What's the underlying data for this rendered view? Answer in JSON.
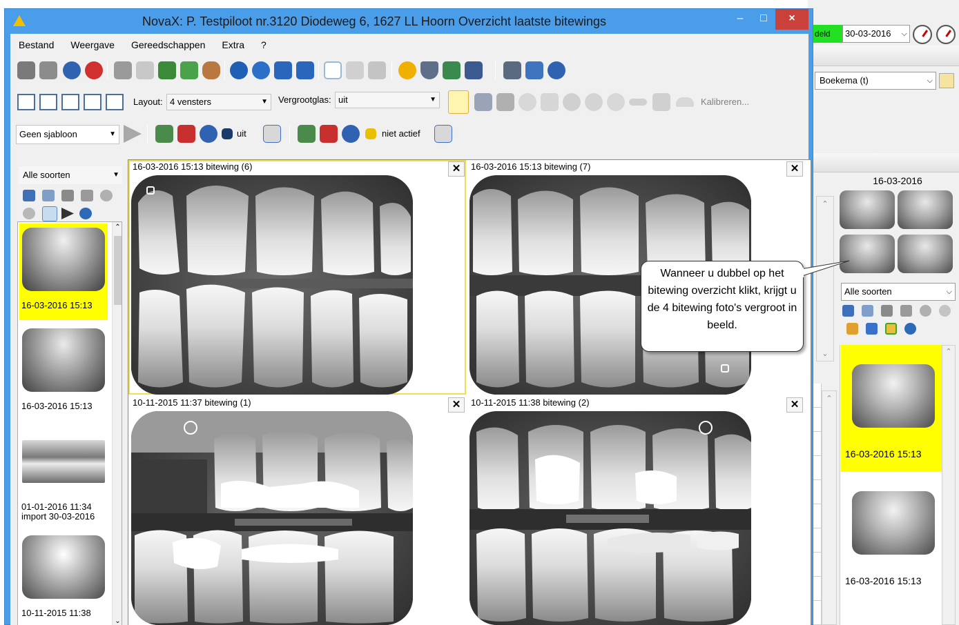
{
  "window": {
    "title": "NovaX: P. Testpiloot nr.3120 Diodeweg 6, 1627 LL Hoorn Overzicht laatste bitewings",
    "minimize_glyph": "–",
    "maximize_glyph": "□",
    "close_glyph": "×"
  },
  "menu": [
    "Bestand",
    "Weergave",
    "Gereedschappen",
    "Extra",
    "?"
  ],
  "toolbar2": {
    "layout_label": "Layout:",
    "layout_value": "4 vensters",
    "zoom_label": "Vergrootglas:",
    "zoom_value": "uit",
    "calibrate_label": "Kalibreren..."
  },
  "toolbar3": {
    "template_value": "Geen sjabloon",
    "status_uit": "uit",
    "status_niet_actief": "niet actief"
  },
  "left_panel": {
    "filter_value": "Alle soorten",
    "thumbnails": [
      {
        "caption": "16-03-2016 15:13",
        "selected": true
      },
      {
        "caption": "16-03-2016 15:13",
        "selected": false
      },
      {
        "caption": "01-01-2016 11:34",
        "caption2": "import 30-03-2016",
        "selected": false
      },
      {
        "caption": "10-11-2015 11:38",
        "selected": false
      }
    ]
  },
  "viewer": {
    "panes": [
      {
        "title": "16-03-2016 15:13 bitewing (6)",
        "active": true
      },
      {
        "title": "16-03-2016 15:13 bitewing (7)",
        "active": false
      },
      {
        "title": "10-11-2015 11:37 bitewing (1)",
        "active": false
      },
      {
        "title": "10-11-2015 11:38 bitewing (2)",
        "active": false
      }
    ],
    "close_glyph": "✕"
  },
  "callout": {
    "text": "Wanneer u dubbel op het bitewing overzicht klikt, krijgt u de 4 bitewing foto's vergroot in beeld."
  },
  "background_app": {
    "green_label": "deld",
    "date_value": "30-03-2016",
    "doctor_value": "Boekema (t)",
    "thumb_date": "16-03-2016",
    "filter_value": "Alle soorten",
    "list_items": [
      "16-03-2016 15:13",
      "16-03-2016 15:13"
    ]
  },
  "colors": {
    "title_bar": "#4a9ee9",
    "selection": "#ffff00",
    "close_button": "#c9413a"
  }
}
